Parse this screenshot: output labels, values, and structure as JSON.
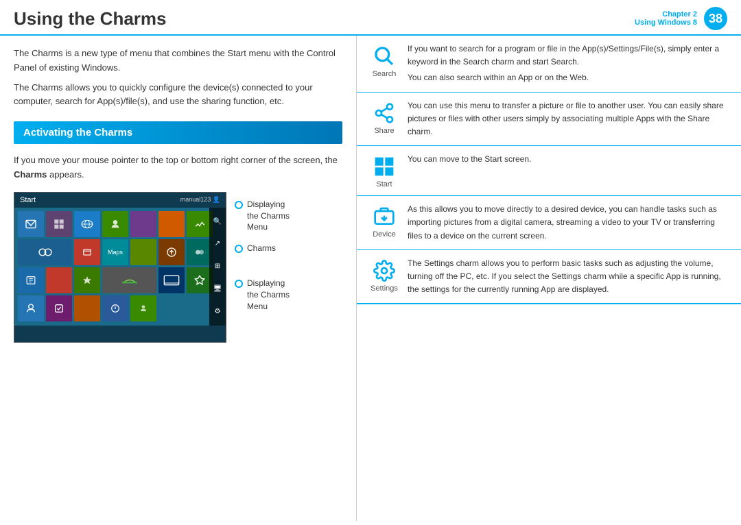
{
  "header": {
    "title": "Using the Charms",
    "chapter_label": "Chapter 2",
    "chapter_sub": "Using Windows 8",
    "chapter_number": "38"
  },
  "left": {
    "intro1": "The Charms is a new type of menu that combines the Start menu with the Control Panel of existing Windows.",
    "intro2": "The Charms allows you to quickly configure the device(s) connected to your computer, search for App(s)/file(s), and use the sharing function, etc.",
    "section_title": "Activating the Charms",
    "activating_text": "If you move your mouse pointer to the top or bottom right corner of the screen, the ",
    "activating_bold": "Charms",
    "activating_text2": " appears.",
    "callout1_line1": "Displaying",
    "callout1_line2": "the Charms",
    "callout1_line3": "Menu",
    "callout2_line1": "Charms",
    "callout3_line1": "Displaying",
    "callout3_line2": "the Charms",
    "callout3_line3": "Menu",
    "screenshot_title": "Start",
    "screenshot_user": "manual123 👤"
  },
  "charms": [
    {
      "name": "Search",
      "desc1": "If you want to search for a program or file in the App(s)/Settings/File(s), simply enter a keyword in the Search charm and start Search.",
      "desc2": "You can also search within an App or on the Web."
    },
    {
      "name": "Share",
      "desc1": "You can use this menu to transfer a picture or file to another user. You can easily share pictures or files with other users simply by associating multiple Apps with the Share charm."
    },
    {
      "name": "Start",
      "desc1": "You can move to the Start screen."
    },
    {
      "name": "Device",
      "desc1": "As this allows you to move directly to a desired device, you can handle tasks such as importing pictures from a digital camera, streaming a video to your TV or transferring files to a device on the current screen."
    },
    {
      "name": "Settings",
      "desc1": "The Settings charm allows you to perform basic tasks such as adjusting the volume, turning off the PC, etc. If you select the Settings charm while a specific App is running, the settings for the currently running App are displayed."
    }
  ]
}
